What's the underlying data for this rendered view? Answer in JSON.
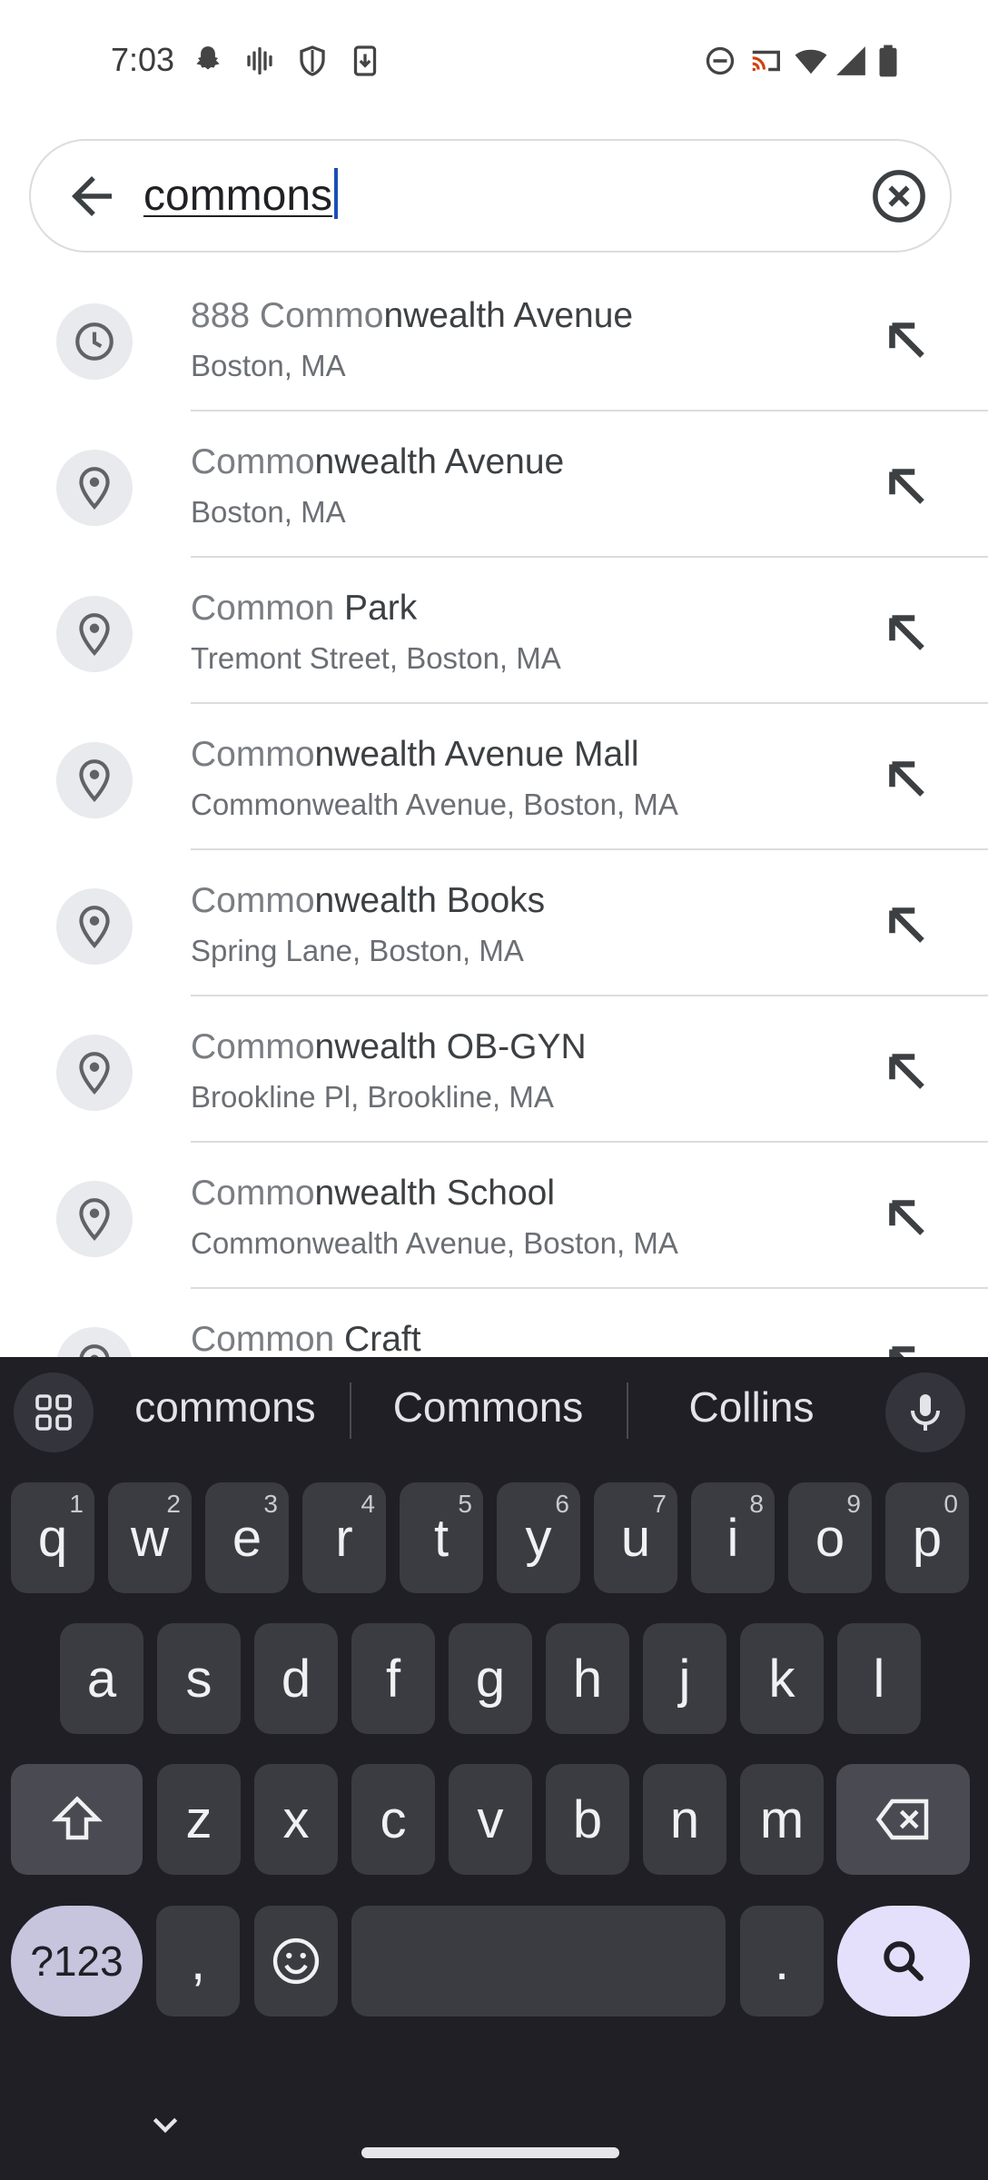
{
  "status_bar": {
    "time": "7:03",
    "left_icons": [
      "snapchat-icon",
      "voice-wave-icon",
      "shield-icon",
      "download-icon"
    ],
    "right_icons": [
      "dnd-icon",
      "cast-icon",
      "wifi-icon",
      "signal-icon",
      "battery-icon"
    ]
  },
  "search": {
    "query": "commons",
    "back_icon": "arrow-back-icon",
    "clear_icon": "clear-circle-icon"
  },
  "results": [
    {
      "icon": "history-icon",
      "title_hl": "888 Commo",
      "title_rest": "nwealth Avenue",
      "subtitle": "Boston, MA"
    },
    {
      "icon": "place-pin-icon",
      "title_hl": "Commo",
      "title_rest": "nwealth Avenue",
      "subtitle": "Boston, MA"
    },
    {
      "icon": "place-pin-icon",
      "title_hl": "Common",
      "title_rest": " Park",
      "subtitle": "Tremont Street, Boston, MA"
    },
    {
      "icon": "place-pin-icon",
      "title_hl": "Commo",
      "title_rest": "nwealth Avenue Mall",
      "subtitle": "Commonwealth Avenue, Boston, MA"
    },
    {
      "icon": "place-pin-icon",
      "title_hl": "Commo",
      "title_rest": "nwealth Books",
      "subtitle": "Spring Lane, Boston, MA"
    },
    {
      "icon": "place-pin-icon",
      "title_hl": "Commo",
      "title_rest": "nwealth OB-GYN",
      "subtitle": "Brookline Pl, Brookline, MA"
    },
    {
      "icon": "place-pin-icon",
      "title_hl": "Commo",
      "title_rest": "nwealth School",
      "subtitle": "Commonwealth Avenue, Boston, MA"
    },
    {
      "icon": "place-pin-icon",
      "title_hl": "Common",
      "title_rest": " Craft",
      "subtitle": ""
    }
  ],
  "keyboard": {
    "suggestions": [
      "commons",
      "Commons",
      "Collins"
    ],
    "row1": [
      {
        "k": "q",
        "h": "1"
      },
      {
        "k": "w",
        "h": "2"
      },
      {
        "k": "e",
        "h": "3"
      },
      {
        "k": "r",
        "h": "4"
      },
      {
        "k": "t",
        "h": "5"
      },
      {
        "k": "y",
        "h": "6"
      },
      {
        "k": "u",
        "h": "7"
      },
      {
        "k": "i",
        "h": "8"
      },
      {
        "k": "o",
        "h": "9"
      },
      {
        "k": "p",
        "h": "0"
      }
    ],
    "row2": [
      "a",
      "s",
      "d",
      "f",
      "g",
      "h",
      "j",
      "k",
      "l"
    ],
    "row3": [
      "z",
      "x",
      "c",
      "v",
      "b",
      "n",
      "m"
    ],
    "symbols_label": "?123",
    "comma_label": ",",
    "period_label": "."
  }
}
